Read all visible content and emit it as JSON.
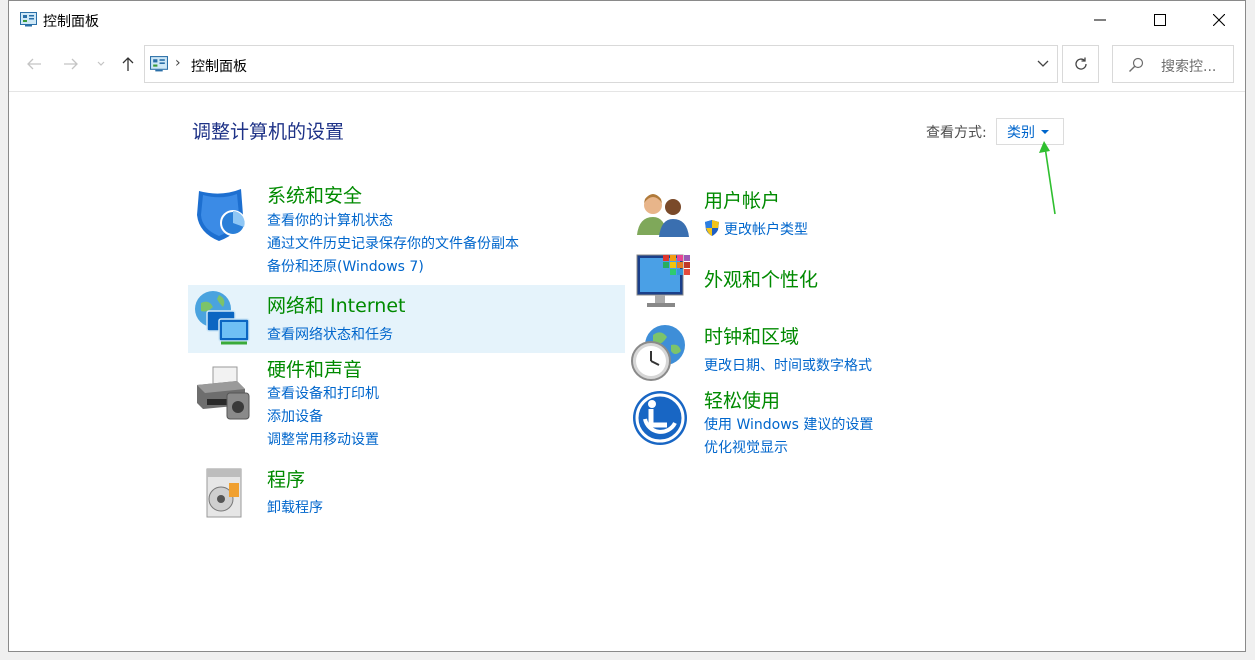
{
  "window": {
    "title": "控制面板"
  },
  "address": {
    "separator": "›",
    "path": "控制面板"
  },
  "search": {
    "placeholder": "搜索控..."
  },
  "content": {
    "heading": "调整计算机的设置",
    "view_by_label": "查看方式:",
    "view_by_value": "类别"
  },
  "categories": {
    "system": {
      "title": "系统和安全",
      "links": [
        "查看你的计算机状态",
        "通过文件历史记录保存你的文件备份副本",
        "备份和还原(Windows 7)"
      ]
    },
    "network": {
      "title": "网络和 Internet",
      "links": [
        "查看网络状态和任务"
      ]
    },
    "hardware": {
      "title": "硬件和声音",
      "links": [
        "查看设备和打印机",
        "添加设备",
        "调整常用移动设置"
      ]
    },
    "programs": {
      "title": "程序",
      "links": [
        "卸载程序"
      ]
    },
    "users": {
      "title": "用户帐户",
      "links": [
        "更改帐户类型"
      ]
    },
    "appearance": {
      "title": "外观和个性化",
      "links": []
    },
    "clock": {
      "title": "时钟和区域",
      "links": [
        "更改日期、时间或数字格式"
      ]
    },
    "ease": {
      "title": "轻松使用",
      "links": [
        "使用 Windows 建议的设置",
        "优化视觉显示"
      ]
    }
  },
  "colors": {
    "category_title": "#008a00",
    "link": "#0066cc",
    "heading": "#1e3287",
    "hover_bg": "#e5f3fb",
    "arrow": "#2fbf2f"
  }
}
